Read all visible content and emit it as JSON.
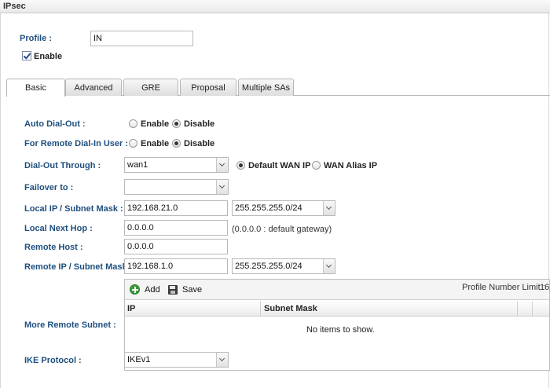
{
  "window": {
    "title": "IPsec"
  },
  "profile": {
    "label": "Profile :",
    "value": "IN",
    "enable_label": "Enable"
  },
  "tabs": [
    {
      "label": "Basic",
      "active": true
    },
    {
      "label": "Advanced"
    },
    {
      "label": "GRE"
    },
    {
      "label": "Proposal"
    },
    {
      "label": "Multiple SAs"
    }
  ],
  "auto_dial_out": {
    "label": "Auto Dial-Out :",
    "options": [
      "Enable",
      "Disable"
    ],
    "selected": "Disable"
  },
  "remote_dial_in": {
    "label": "For Remote Dial-In User :",
    "options": [
      "Enable",
      "Disable"
    ],
    "selected": "Disable"
  },
  "dial_out_through": {
    "label": "Dial-Out Through :",
    "value": "wan1",
    "ip_options": [
      "Default WAN IP",
      "WAN Alias IP"
    ],
    "ip_selected": "Default WAN IP"
  },
  "failover": {
    "label": "Failover to :",
    "value": ""
  },
  "local_ip": {
    "label": "Local IP / Subnet Mask :",
    "ip": "192.168.21.0",
    "mask": "255.255.255.0/24"
  },
  "local_next_hop": {
    "label": "Local Next Hop :",
    "value": "0.0.0.0",
    "hint": "(0.0.0.0 : default gateway)"
  },
  "remote_host": {
    "label": "Remote Host :",
    "value": "0.0.0.0"
  },
  "remote_ip": {
    "label": "Remote IP / Subnet Mask :",
    "ip": "192.168.1.0",
    "mask": "255.255.255.0/24"
  },
  "more_remote_subnet": {
    "label": "More Remote Subnet :",
    "add_label": "Add",
    "save_label": "Save",
    "limit_label": "Profile Number Limit :",
    "limit_value": "16",
    "columns": [
      "IP",
      "Subnet Mask"
    ],
    "empty_text": "No items to show."
  },
  "ike_protocol": {
    "label": "IKE Protocol :",
    "value": "IKEv1"
  },
  "colors": {
    "label": "#1e4f7e",
    "border": "#b9b9b9",
    "add_icon": "#3c9a3c"
  },
  "icons": [
    "add-icon",
    "save-icon",
    "chevron-down-icon",
    "checkmark-icon"
  ]
}
